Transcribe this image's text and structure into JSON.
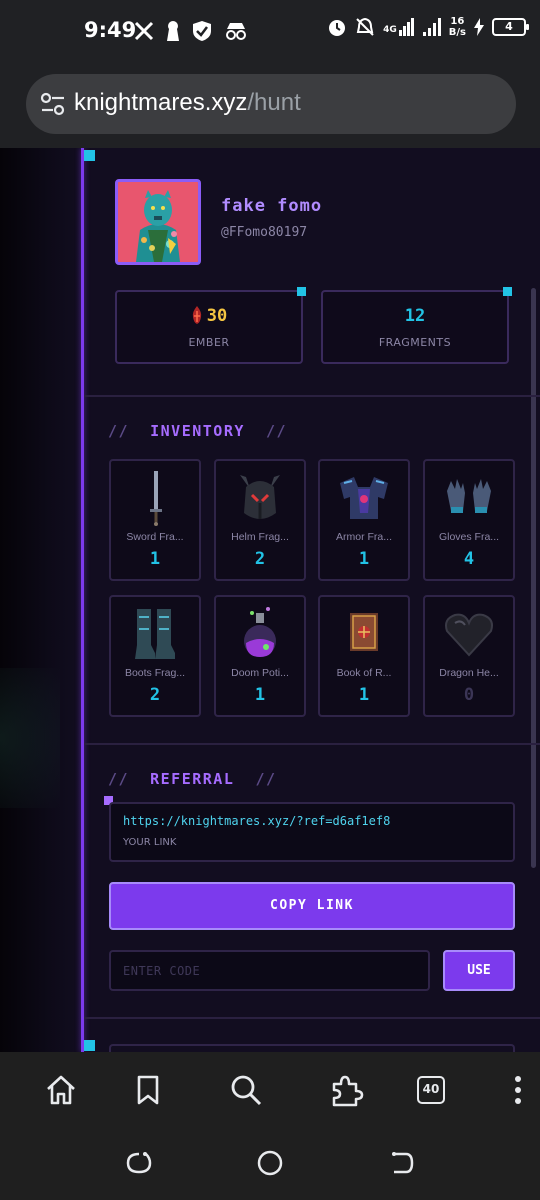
{
  "status_bar": {
    "time": "9:49",
    "network_label": "4G",
    "speed_value": "16",
    "speed_unit": "B/s",
    "battery": "4",
    "left_icons": [
      "x-logo-icon",
      "keyhole-icon",
      "shield-check-icon",
      "incognito-icon"
    ],
    "right_icons": [
      "alarm-icon",
      "bell-off-icon",
      "signal-icon",
      "signal-icon",
      "charging-icon"
    ]
  },
  "browser": {
    "url_host": "knightmares.xyz",
    "url_path": "/hunt",
    "tab_count": "40",
    "toolbar_icons": [
      "home-icon",
      "bookmark-icon",
      "search-icon",
      "extensions-icon",
      "tabs-icon",
      "more-icon"
    ]
  },
  "profile": {
    "name": "fake fomo",
    "handle": "@FFomo80197"
  },
  "stats": {
    "ember_value": "30",
    "ember_label": "EMBER",
    "fragments_value": "12",
    "fragments_label": "FRAGMENTS"
  },
  "inventory": {
    "title": "INVENTORY",
    "slashes": "//",
    "items": [
      {
        "name": "Sword Fra...",
        "count": "1",
        "icon": "sword-icon"
      },
      {
        "name": "Helm Frag...",
        "count": "2",
        "icon": "helm-icon"
      },
      {
        "name": "Armor Fra...",
        "count": "1",
        "icon": "armor-icon"
      },
      {
        "name": "Gloves Fra...",
        "count": "4",
        "icon": "gloves-icon"
      },
      {
        "name": "Boots Frag...",
        "count": "2",
        "icon": "boots-icon"
      },
      {
        "name": "Doom Poti...",
        "count": "1",
        "icon": "potion-icon"
      },
      {
        "name": "Book of R...",
        "count": "1",
        "icon": "book-icon"
      },
      {
        "name": "Dragon He...",
        "count": "0",
        "icon": "dragon-heart-icon"
      }
    ]
  },
  "referral": {
    "title": "REFERRAL",
    "slashes": "//",
    "link": "https://knightmares.xyz/?ref=d6af1ef8",
    "link_label": "YOUR LINK",
    "copy_label": "COPY LINK",
    "code_placeholder": "ENTER CODE",
    "use_label": "USE"
  },
  "colors": {
    "accent": "#7c3aed",
    "cyan": "#22c3e6",
    "ember": "#f5c542",
    "title_purple": "#a66cff"
  }
}
